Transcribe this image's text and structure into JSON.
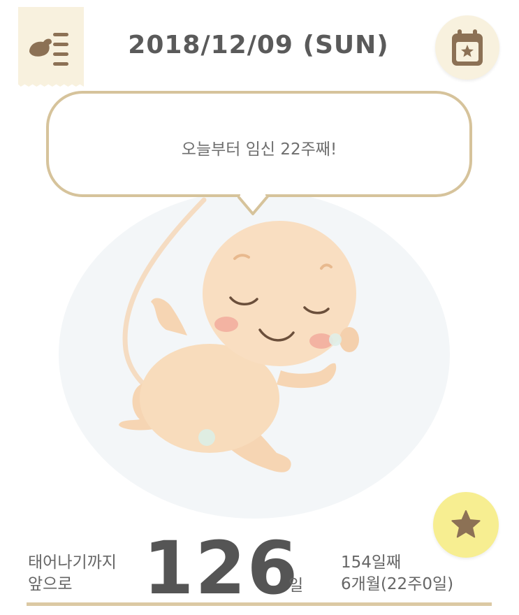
{
  "header": {
    "date": "2018/12/09 (SUN)"
  },
  "speech_bubble": {
    "message": "오늘부터 임신 22주째!"
  },
  "countdown": {
    "prefix_line1": "태어나기까지",
    "prefix_line2": "앞으로",
    "days_remaining": "126",
    "unit": "일",
    "day_count": "154일째",
    "month_week": "6개월(22주0일)"
  },
  "icons": {
    "menu": "bird-list-icon",
    "calendar": "calendar-star-icon",
    "favorite": "star-icon"
  },
  "colors": {
    "accent_brown": "#8c7155",
    "tab_cream": "#f8f1de",
    "bubble_border": "#d6c39b",
    "star_yellow": "#f7ee91",
    "divider": "#dcc9a3"
  }
}
